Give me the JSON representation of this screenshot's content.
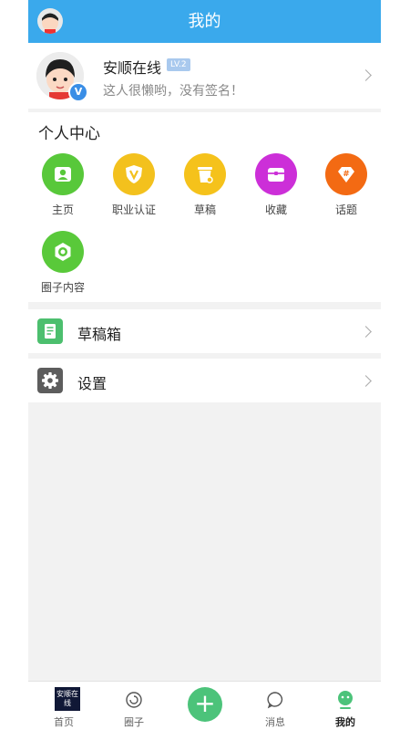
{
  "header": {
    "title": "我的"
  },
  "profile": {
    "name": "安顺在线",
    "level": "LV.2",
    "signature": "这人很懒哟，没有签名！",
    "badge": "V"
  },
  "personal_center": {
    "title": "个人中心",
    "items": [
      {
        "label": "主页",
        "icon": "person-icon",
        "color": "#58c83a"
      },
      {
        "label": "职业认证",
        "icon": "shield-v-icon",
        "color": "#f3c11d"
      },
      {
        "label": "草稿",
        "icon": "trash-draft-icon",
        "color": "#f5c21b"
      },
      {
        "label": "收藏",
        "icon": "box-icon",
        "color": "#cc2fd8"
      },
      {
        "label": "话题",
        "icon": "hashtag-gem-icon",
        "color": "#f36a13"
      },
      {
        "label": "圈子内容",
        "icon": "camera-lens-icon",
        "color": "#59c93a"
      }
    ]
  },
  "rows": {
    "drafts": {
      "label": "草稿箱",
      "icon": "document-icon",
      "color": "#4cbf6e"
    },
    "settings": {
      "label": "设置",
      "icon": "gear-icon",
      "color": "#5d5d5d"
    }
  },
  "tabbar": {
    "logo_text": "安顺在线",
    "items": [
      {
        "label": "首页"
      },
      {
        "label": "圈子"
      },
      {
        "label": "+"
      },
      {
        "label": "消息"
      },
      {
        "label": "我的"
      }
    ]
  }
}
